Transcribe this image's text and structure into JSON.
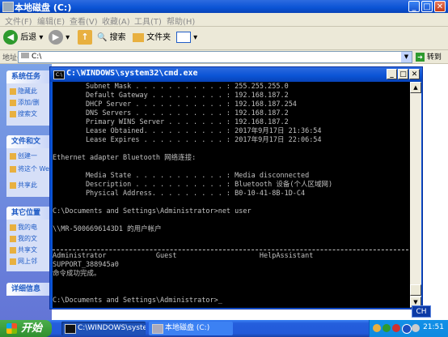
{
  "explorer": {
    "title": "本地磁盘 (C:)",
    "menu": [
      "文件(F)",
      "编辑(E)",
      "查看(V)",
      "收藏(A)",
      "工具(T)",
      "帮助(H)"
    ],
    "toolbar": {
      "back": "后退",
      "search": "搜索",
      "folders": "文件夹"
    },
    "address_label": "地址(D)",
    "address_value": "C:\\",
    "go": "转到",
    "left_panels": [
      {
        "header": "系统任务",
        "items": [
          "隐藏此",
          "添加/删",
          "搜索文"
        ]
      },
      {
        "header": "文件和文",
        "items": [
          "创建一",
          "将这个 Web",
          "共享此"
        ]
      },
      {
        "header": "其它位置",
        "items": [
          "我的电",
          "我的文",
          "共享文",
          "网上邻"
        ]
      },
      {
        "header": "详细信息",
        "items": []
      }
    ]
  },
  "cmd": {
    "title": "C:\\WINDOWS\\system32\\cmd.exe",
    "lines": [
      "        Subnet Mask . . . . . . . . . . . : 255.255.255.0",
      "        Default Gateway . . . . . . . . . : 192.168.187.2",
      "        DHCP Server . . . . . . . . . . . : 192.168.187.254",
      "        DNS Servers . . . . . . . . . . . : 192.168.187.2",
      "        Primary WINS Server . . . . . . . : 192.168.187.2",
      "        Lease Obtained. . . . . . . . . . : 2017年9月17日 21:36:54",
      "        Lease Expires . . . . . . . . . . : 2017年9月17日 22:06:54",
      "",
      "Ethernet adapter Bluetooth 网络连接:",
      "",
      "        Media State . . . . . . . . . . . : Media disconnected",
      "        Description . . . . . . . . . . . : Bluetooth 设备(个人区域网)",
      "        Physical Address. . . . . . . . . : B0-10-41-8B-1D-C4",
      "",
      "C:\\Documents and Settings\\Administrator>net user",
      "",
      "\\\\MR-5006696143D1 的用户帐户",
      "",
      "",
      "Administrator            Guest                    HelpAssistant",
      "SUPPORT_388945a0",
      "命令成功完成。",
      "",
      "",
      "C:\\Documents and Settings\\Administrator>_"
    ]
  },
  "taskbar": {
    "start": "开始",
    "tasks": [
      "C:\\WINDOWS\\syste...",
      "本地磁盘 (C:)"
    ],
    "ime": "CH",
    "clock": "21:51"
  }
}
